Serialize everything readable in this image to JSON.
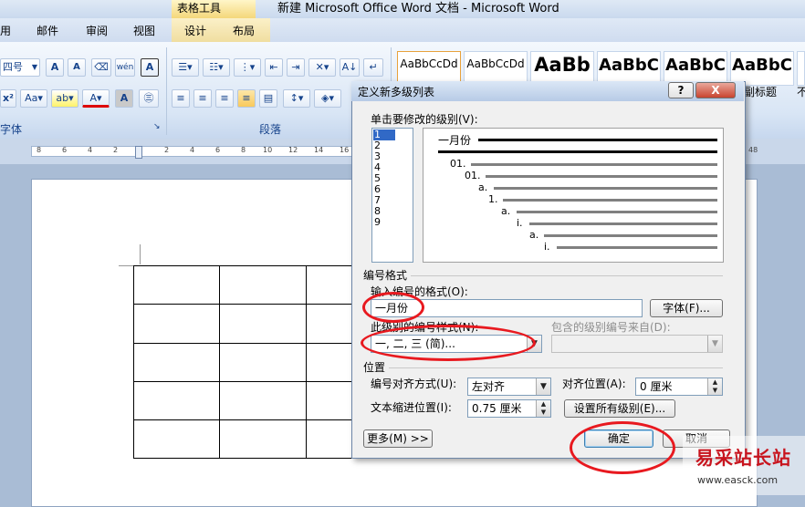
{
  "window": {
    "title": "新建 Microsoft Office Word 文档 - Microsoft Word",
    "context_tab_group": "表格工具"
  },
  "ribbon_tabs": [
    "用",
    "邮件",
    "审阅",
    "视图",
    "设计",
    "布局"
  ],
  "ribbon": {
    "font_size_value": "四号",
    "groups": {
      "font": "字体",
      "paragraph": "段落"
    },
    "styles": [
      {
        "sample": "AaBbCcDd",
        "name": ""
      },
      {
        "sample": "AaBbCcDd",
        "name": ""
      },
      {
        "sample": "AaBb",
        "name": ""
      },
      {
        "sample": "AaBbC",
        "name": ""
      },
      {
        "sample": "AaBbC",
        "name": ""
      },
      {
        "sample": "AaBbC",
        "name": "副标题"
      },
      {
        "sample": "",
        "name": "不"
      }
    ]
  },
  "ruler": {
    "ticks": [
      "8",
      "6",
      "4",
      "2",
      "2",
      "4",
      "6",
      "8",
      "10",
      "12",
      "14",
      "16",
      "48"
    ]
  },
  "dialog": {
    "title": "定义新多级列表",
    "help_button": "?",
    "close_button": "X",
    "level_label": "单击要修改的级别(V):",
    "levels": [
      "1",
      "2",
      "3",
      "4",
      "5",
      "6",
      "7",
      "8",
      "9"
    ],
    "selected_level": "1",
    "preview": {
      "level1_text": "一月份",
      "sub_items": [
        "01.",
        "01.",
        "a.",
        "1.",
        "a.",
        "i.",
        "a.",
        "i."
      ]
    },
    "number_format_section": "编号格式",
    "enter_format_label": "输入编号的格式(O):",
    "format_value": "一月份",
    "font_button": "字体(F)...",
    "style_label": "此级别的编号样式(N):",
    "style_value": "一, 二, 三 (简)...",
    "include_label": "包含的级别编号来自(D):",
    "include_value": "",
    "position_section": "位置",
    "alignment_label": "编号对齐方式(U):",
    "alignment_value": "左对齐",
    "align_at_label": "对齐位置(A):",
    "align_at_value": "0 厘米",
    "indent_label": "文本缩进位置(I):",
    "indent_value": "0.75 厘米",
    "set_all_button": "设置所有级别(E)...",
    "more_button": "更多(M) >>",
    "ok_button": "确定",
    "cancel_button": "取消"
  },
  "watermark": {
    "site_name": "易采站长站",
    "url": "www.easck.com"
  },
  "colors": {
    "highlight_ellipse": "#e8191f",
    "ribbon_label": "#15428b"
  }
}
